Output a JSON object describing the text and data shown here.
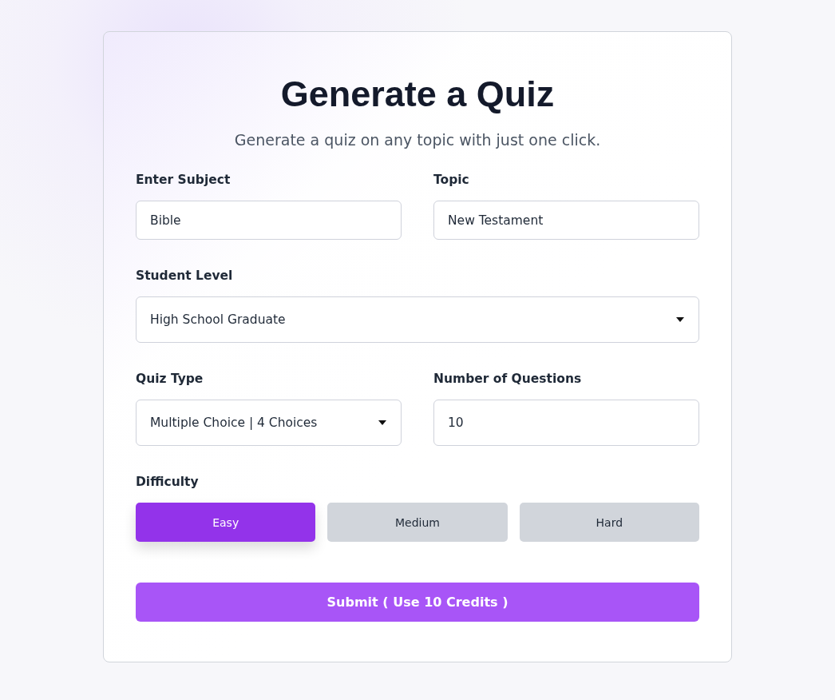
{
  "title": "Generate a Quiz",
  "subtitle": "Generate a quiz on any topic with just one click.",
  "rows": [
    [
      {
        "kind": "text",
        "label": "Enter Subject",
        "value": "Bible"
      },
      {
        "kind": "text",
        "label": "Topic",
        "value": "New Testament"
      }
    ],
    [
      {
        "kind": "select",
        "label": "Student Level",
        "value": "High School Graduate"
      }
    ],
    [
      {
        "kind": "select",
        "label": "Quiz Type",
        "value": "Multiple Choice | 4 Choices"
      },
      {
        "kind": "text",
        "label": "Number of Questions",
        "value": "10"
      }
    ]
  ],
  "difficulty": {
    "label": "Difficulty",
    "options": [
      {
        "label": "Easy",
        "selected": true
      },
      {
        "label": "Medium",
        "selected": false
      },
      {
        "label": "Hard",
        "selected": false
      }
    ]
  },
  "submit": "Submit ( Use 10 Credits )"
}
